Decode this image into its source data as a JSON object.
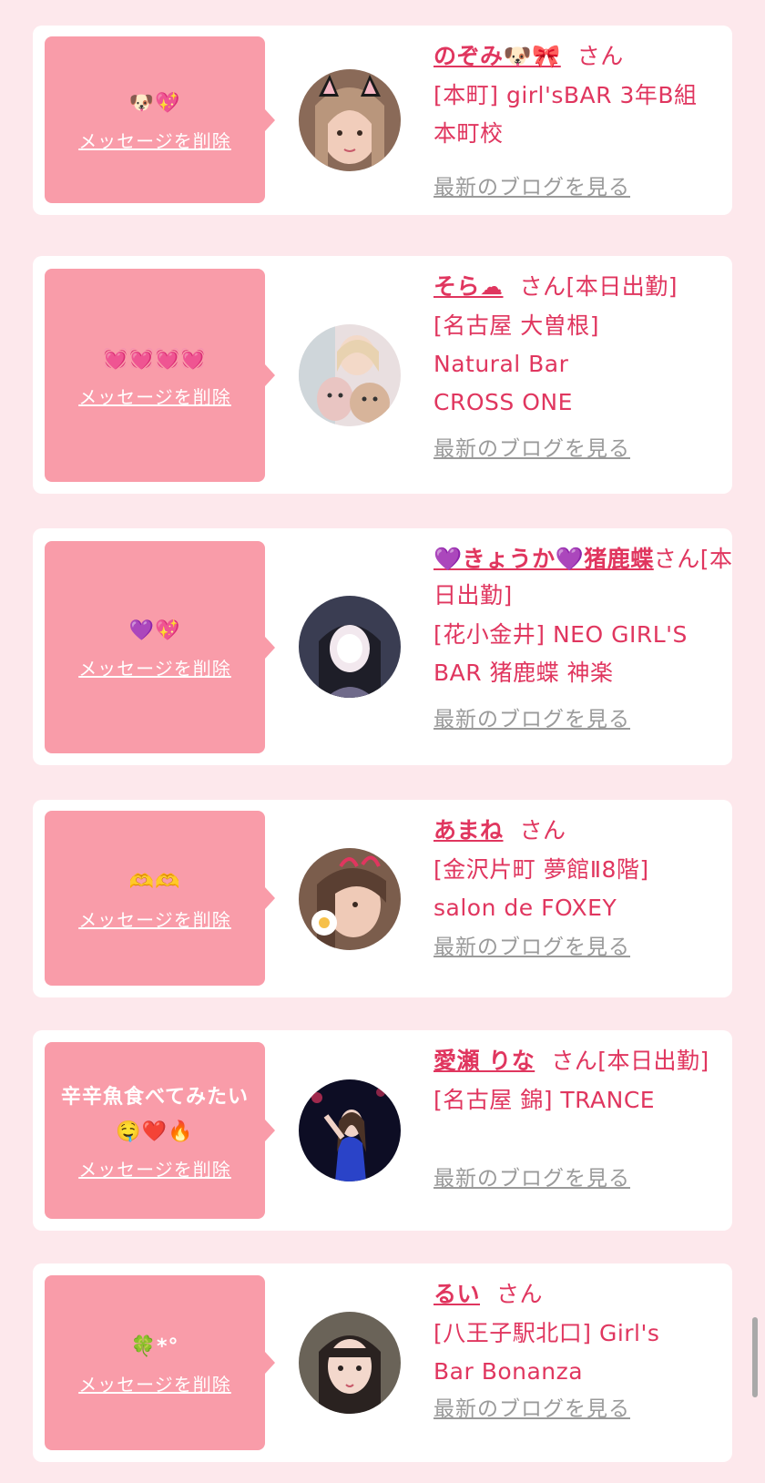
{
  "delete_label": "メッセージを削除",
  "blog_label": "最新のブログを見る",
  "san_label": "さん",
  "colors": {
    "background": "#fde8ec",
    "bubble": "#f99ca9",
    "accent": "#e0365f",
    "link_gray": "#9a9a9a"
  },
  "messages": [
    {
      "bubble_text": "🐶💖",
      "name": "のぞみ🐶🎀",
      "san": "さん",
      "shop": "[本町] girl'sBAR 3年B組 本町校"
    },
    {
      "bubble_text": "💓💓💓💓",
      "name": "そら☁",
      "san": "さん[本日出勤]",
      "shop": "[名古屋 大曽根] Natural Bar CROSS ONE"
    },
    {
      "bubble_text": "💜💖",
      "name": "💜きょうか💜猪鹿蝶",
      "san": "さん[本日出勤]",
      "shop": "[花小金井] NEO GIRL'S BAR 猪鹿蝶 神楽"
    },
    {
      "bubble_text": "🫶🫶",
      "name": "あまね",
      "san": "さん",
      "shop": "[金沢片町 夢館Ⅱ8階] salon de FOXEY"
    },
    {
      "bubble_text": "辛辛魚食べてみたい🤤❤️🔥",
      "name": "愛瀬 りな",
      "san": "さん[本日出勤]",
      "shop": "[名古屋 錦] TRANCE"
    },
    {
      "bubble_text": "🍀*°",
      "name": "るい",
      "san": "さん",
      "shop": "[八王子駅北口] Girl's Bar Bonanza"
    }
  ]
}
